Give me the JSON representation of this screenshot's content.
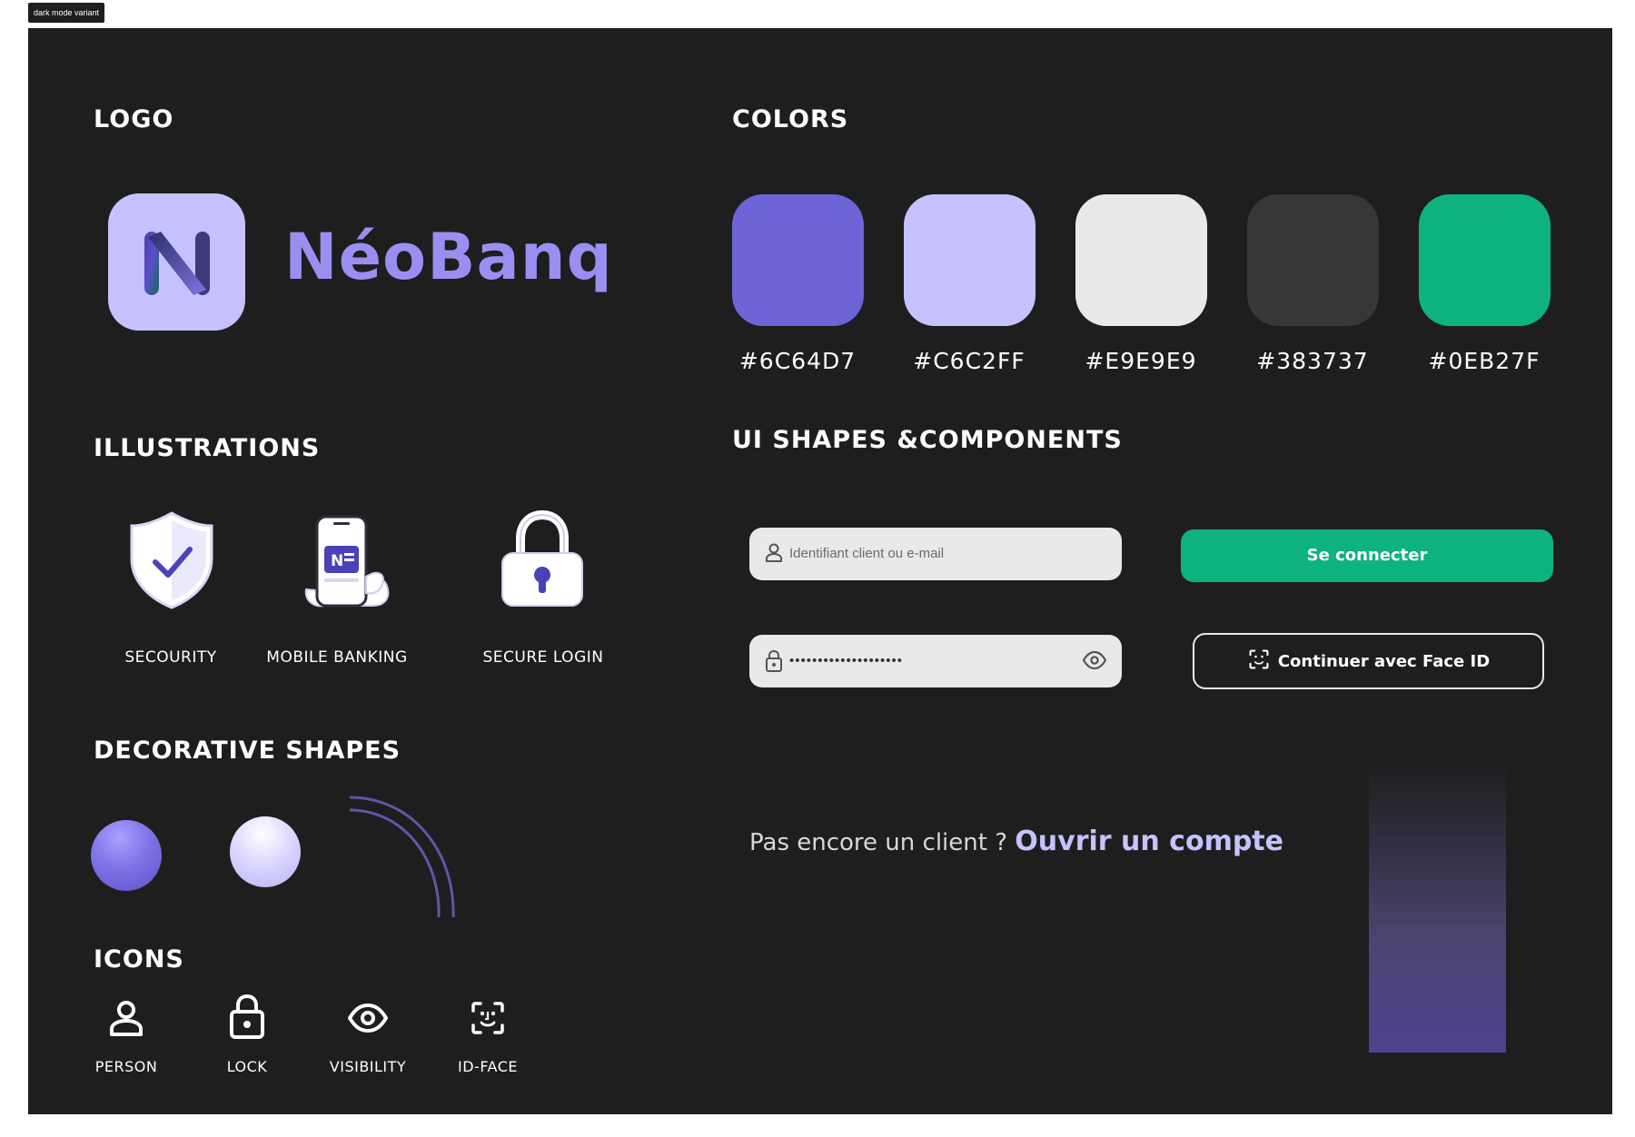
{
  "frame": {
    "tag": "dark mode variant"
  },
  "sections": {
    "logo": "LOGO",
    "colors": "COLORS",
    "illustrations": "ILLUSTRATIONS",
    "ui_components": "UI SHAPES &COMPONENTS",
    "decorative": "DECORATIVE SHAPES",
    "icons": "ICONS"
  },
  "logo": {
    "letter": "N",
    "wordmark": "NéoBanq"
  },
  "colors": [
    {
      "label": "#6C64D7",
      "hex": "#6C64D7"
    },
    {
      "label": "#C6C2FF",
      "hex": "#C6C2FF"
    },
    {
      "label": "#E9E9E9",
      "hex": "#E9E9E9"
    },
    {
      "label": "#383737",
      "hex": "#383737"
    },
    {
      "label": "#0EB27F",
      "hex": "#0EB27F"
    }
  ],
  "illustrations": [
    {
      "label": "SECOURITY",
      "icon": "shield-check-icon"
    },
    {
      "label": "MOBILE BANKING",
      "icon": "phone-hand-icon"
    },
    {
      "label": "SECURE LOGIN",
      "icon": "padlock-icon"
    }
  ],
  "decorative_shapes": [
    "purple-orb",
    "lavender-orb",
    "arc-lines"
  ],
  "icons": [
    {
      "label": "PERSON",
      "icon": "person-icon"
    },
    {
      "label": "LOCK",
      "icon": "lock-icon"
    },
    {
      "label": "VISIBILITY",
      "icon": "visibility-icon"
    },
    {
      "label": "ID-FACE",
      "icon": "face-id-icon"
    }
  ],
  "login_form": {
    "username_placeholder": "Identifiant client ou e-mail",
    "password_value": "••••••••••••••••••••",
    "login_button": "Se connecter",
    "faceid_button": "Continuer avec Face ID",
    "signup_prompt": "Pas encore un client ?",
    "signup_link": "Ouvrir un compte"
  },
  "palette": {
    "background": "#1E1E1E",
    "primary": "#6C64D7",
    "accent": "#C6C2FF",
    "success": "#0EB27F"
  }
}
